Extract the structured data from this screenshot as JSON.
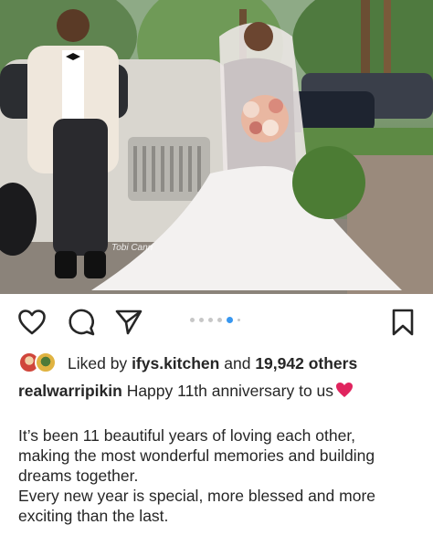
{
  "post": {
    "photo_watermark": "Tobi Cann",
    "carousel": {
      "count": 6,
      "active_index": 4
    },
    "likes": {
      "prefix": "Liked by",
      "user": "ifys.kitchen",
      "connector": "and",
      "others": "19,942 others"
    },
    "caption": {
      "username": "realwarripikin",
      "text": "Happy 11th anniversary to us"
    },
    "body_lines": [
      "It’s been 11 beautiful years of loving each other,",
      "making  the most wonderful memories and building",
      "dreams together.",
      "Every new year is special, more blessed and more",
      "exciting than the last."
    ]
  },
  "icons": {
    "like": "heart-outline-icon",
    "comment": "comment-bubble-icon",
    "share": "paper-plane-icon",
    "save": "bookmark-icon"
  },
  "colors": {
    "text": "#262626",
    "carousel_active": "#3897f0",
    "carousel_inactive": "#c7c7c7",
    "heart_emoji": "#e0245e"
  }
}
